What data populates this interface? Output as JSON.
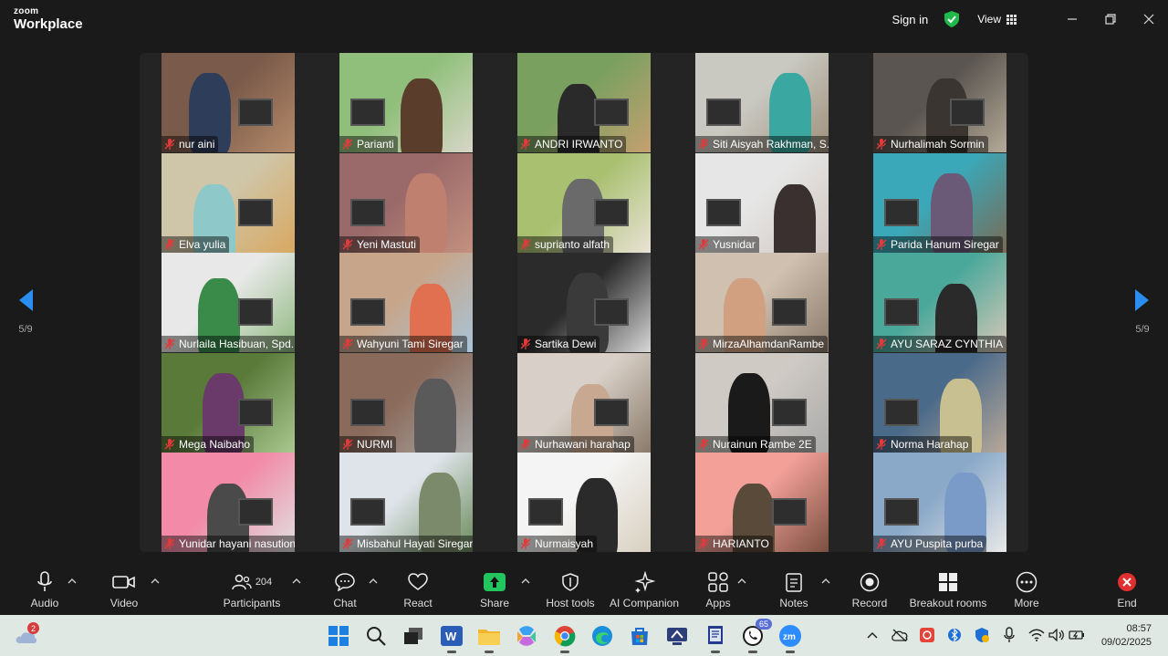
{
  "app": {
    "brand_top": "zoom",
    "brand_bottom": "Workplace"
  },
  "titlebar": {
    "sign_in": "Sign in",
    "view": "View"
  },
  "pagination": {
    "left": "5/9",
    "right": "5/9"
  },
  "participants": [
    {
      "name": "nur aini"
    },
    {
      "name": "Parianti"
    },
    {
      "name": "ANDRI IRWANTO"
    },
    {
      "name": "Siti Aisyah Rakhman, S.Pd.I"
    },
    {
      "name": "Nurhalimah Sormin"
    },
    {
      "name": "Elva yulia"
    },
    {
      "name": "Yeni Mastuti"
    },
    {
      "name": "suprianto alfath"
    },
    {
      "name": "Yusnidar"
    },
    {
      "name": "Parida Hanum Siregar"
    },
    {
      "name": "Nurlaila Hasibuan, Spd.I"
    },
    {
      "name": "Wahyuni Tami Siregar"
    },
    {
      "name": "Sartika Dewi"
    },
    {
      "name": "MirzaAlhamdanRambe"
    },
    {
      "name": "AYU SARAZ CYNTHIA"
    },
    {
      "name": "Mega Naibaho"
    },
    {
      "name": "NURMI"
    },
    {
      "name": "Nurhawani harahap"
    },
    {
      "name": "Nurainun Rambe 2E"
    },
    {
      "name": "Norma Harahap"
    },
    {
      "name": "Yunidar hayani nasution spdi"
    },
    {
      "name": "Misbahul Hayati Siregar"
    },
    {
      "name": "Nurmaisyah"
    },
    {
      "name": "HARIANTO"
    },
    {
      "name": "AYU Puspita purba"
    }
  ],
  "toolbar": {
    "audio": "Audio",
    "video": "Video",
    "participants": "Participants",
    "participants_count": "204",
    "chat": "Chat",
    "react": "React",
    "share": "Share",
    "host_tools": "Host tools",
    "ai_companion": "AI Companion",
    "apps": "Apps",
    "notes": "Notes",
    "record": "Record",
    "breakout_rooms": "Breakout rooms",
    "more": "More",
    "end": "End"
  },
  "taskbar": {
    "weather_badge": "2",
    "whatsapp_badge": "65",
    "time": "08:57",
    "date": "09/02/2025"
  },
  "colors": {
    "accent_green": "#1fb84a",
    "share_green": "#22c55e",
    "end_red": "#e02f2f",
    "nav_blue": "#2a8ef0"
  }
}
